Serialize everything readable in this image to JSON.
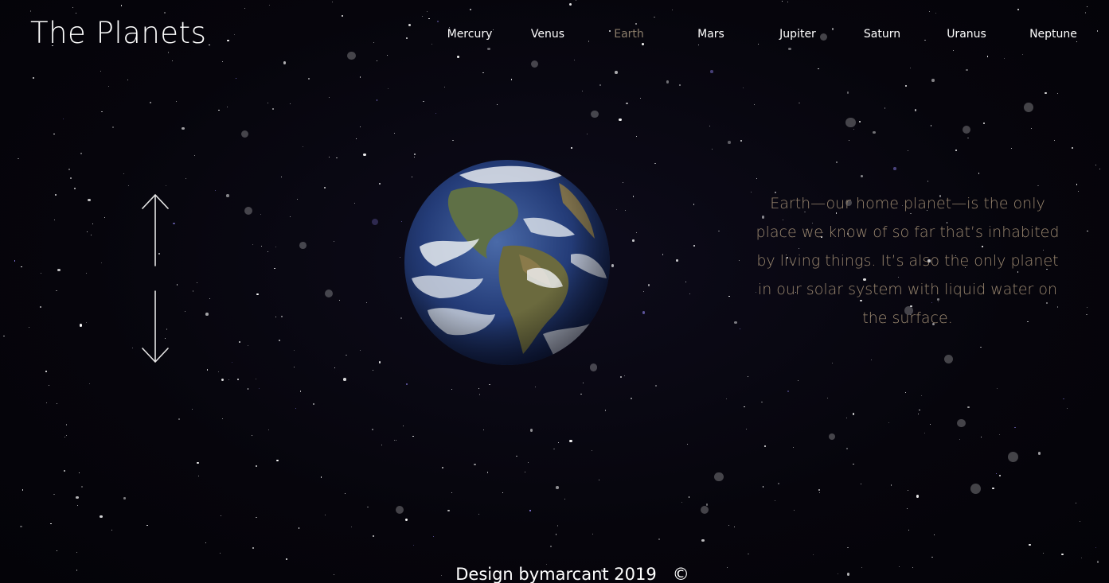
{
  "header": {
    "title": "The Planets"
  },
  "nav": {
    "items": [
      {
        "label": "Mercury",
        "active": false
      },
      {
        "label": "Venus",
        "active": false
      },
      {
        "label": "Earth",
        "active": true
      },
      {
        "label": "Mars",
        "active": false
      },
      {
        "label": "Jupiter",
        "active": false
      },
      {
        "label": "Saturn",
        "active": false
      },
      {
        "label": "Uranus",
        "active": false
      },
      {
        "label": "Neptune",
        "active": false
      }
    ]
  },
  "main": {
    "planet_image": "earth",
    "description": "Earth—our home planet—is the only place we know of so far that’s inhabited by living things. It’s also the only planet in our solar system with liquid water on the surface.",
    "scroll_up_icon": "arrow-up-icon",
    "scroll_down_icon": "arrow-down-icon"
  },
  "footer": {
    "text": "Design bymarcant 2019",
    "copyright_symbol": "©"
  },
  "colors": {
    "background": "#07060e",
    "accent": "#9a876f",
    "active_nav": "#8a7c6a",
    "text": "#ffffff"
  }
}
